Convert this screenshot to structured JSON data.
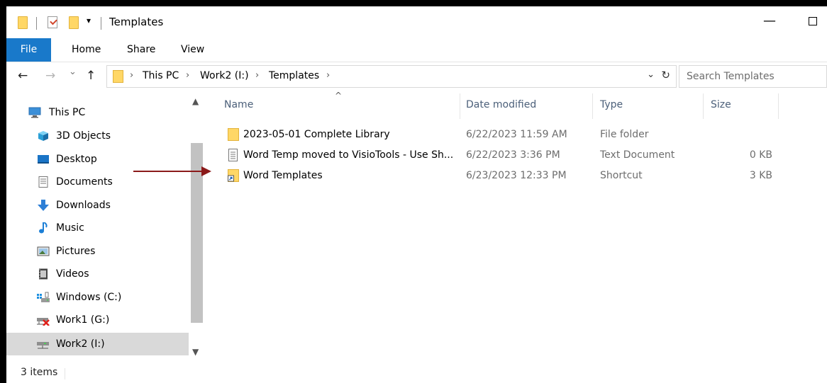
{
  "window": {
    "title": "Templates",
    "quick_access_dropdown": "▾",
    "minimize_glyph": "—"
  },
  "ribbon": {
    "tabs": [
      {
        "label": "File"
      },
      {
        "label": "Home"
      },
      {
        "label": "Share"
      },
      {
        "label": "View"
      }
    ]
  },
  "address": {
    "back": "←",
    "forward": "→",
    "recent": "⌄",
    "up": "↑",
    "separator": "›",
    "dropdown": "⌄",
    "refresh": "↻",
    "breadcrumbs": [
      "This PC",
      "Work2 (I:)",
      "Templates"
    ]
  },
  "search": {
    "placeholder": "Search Templates"
  },
  "nav_pane": {
    "scroll_up": "▲",
    "scroll_down": "▼",
    "items": [
      {
        "label": "This PC",
        "icon": "computer-icon"
      },
      {
        "label": "3D Objects",
        "icon": "cube-icon"
      },
      {
        "label": "Desktop",
        "icon": "desktop-icon"
      },
      {
        "label": "Documents",
        "icon": "document-icon"
      },
      {
        "label": "Downloads",
        "icon": "download-icon"
      },
      {
        "label": "Music",
        "icon": "music-icon"
      },
      {
        "label": "Pictures",
        "icon": "pictures-icon"
      },
      {
        "label": "Videos",
        "icon": "video-icon"
      },
      {
        "label": "Windows (C:)",
        "icon": "windows-drive-icon"
      },
      {
        "label": "Work1 (G:)",
        "icon": "network-drive-disconnected-icon"
      },
      {
        "label": "Work2 (I:)",
        "icon": "network-drive-icon",
        "selected": true
      }
    ]
  },
  "file_list": {
    "sort_indicator": "^",
    "columns": [
      "Name",
      "Date modified",
      "Type",
      "Size"
    ],
    "rows": [
      {
        "name": "2023-05-01 Complete Library",
        "date": "6/22/2023 11:59 AM",
        "type": "File folder",
        "size": "",
        "icon": "folder-icon"
      },
      {
        "name": "Word Temp moved to VisioTools - Use Sh...",
        "date": "6/22/2023 3:36 PM",
        "type": "Text Document",
        "size": "0 KB",
        "icon": "text-file-icon"
      },
      {
        "name": "Word Templates",
        "date": "6/23/2023 12:33 PM",
        "type": "Shortcut",
        "size": "3 KB",
        "icon": "folder-shortcut-icon"
      }
    ]
  },
  "status": {
    "item_count": "3 items"
  },
  "colors": {
    "file_tab": "#1979ca",
    "folder": "#ffd766",
    "selection": "#d9d9d9",
    "arrow": "#8b1a1a",
    "column_header": "#4c607a"
  }
}
